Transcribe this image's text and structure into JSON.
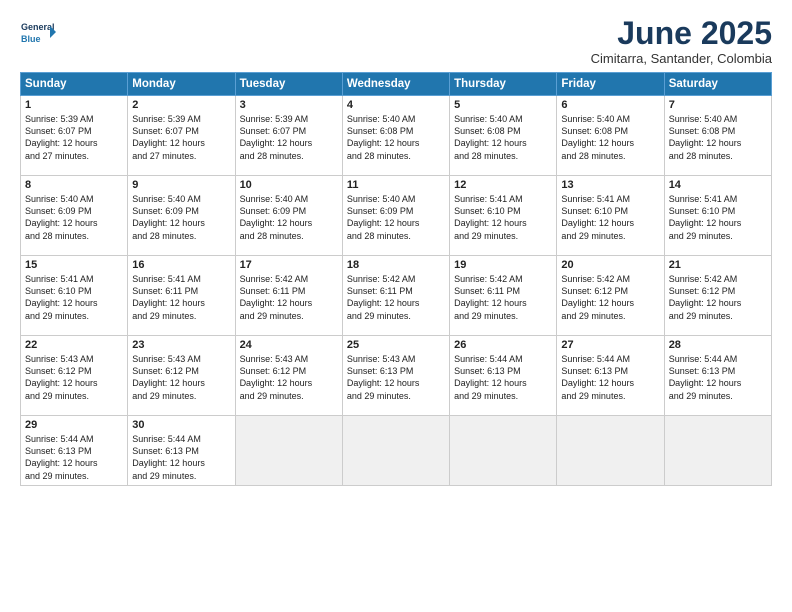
{
  "logo": {
    "line1": "General",
    "line2": "Blue"
  },
  "title": "June 2025",
  "location": "Cimitarra, Santander, Colombia",
  "weekdays": [
    "Sunday",
    "Monday",
    "Tuesday",
    "Wednesday",
    "Thursday",
    "Friday",
    "Saturday"
  ],
  "weeks": [
    [
      {
        "day": "1",
        "info": "Sunrise: 5:39 AM\nSunset: 6:07 PM\nDaylight: 12 hours\nand 27 minutes."
      },
      {
        "day": "2",
        "info": "Sunrise: 5:39 AM\nSunset: 6:07 PM\nDaylight: 12 hours\nand 27 minutes."
      },
      {
        "day": "3",
        "info": "Sunrise: 5:39 AM\nSunset: 6:07 PM\nDaylight: 12 hours\nand 28 minutes."
      },
      {
        "day": "4",
        "info": "Sunrise: 5:40 AM\nSunset: 6:08 PM\nDaylight: 12 hours\nand 28 minutes."
      },
      {
        "day": "5",
        "info": "Sunrise: 5:40 AM\nSunset: 6:08 PM\nDaylight: 12 hours\nand 28 minutes."
      },
      {
        "day": "6",
        "info": "Sunrise: 5:40 AM\nSunset: 6:08 PM\nDaylight: 12 hours\nand 28 minutes."
      },
      {
        "day": "7",
        "info": "Sunrise: 5:40 AM\nSunset: 6:08 PM\nDaylight: 12 hours\nand 28 minutes."
      }
    ],
    [
      {
        "day": "8",
        "info": "Sunrise: 5:40 AM\nSunset: 6:09 PM\nDaylight: 12 hours\nand 28 minutes."
      },
      {
        "day": "9",
        "info": "Sunrise: 5:40 AM\nSunset: 6:09 PM\nDaylight: 12 hours\nand 28 minutes."
      },
      {
        "day": "10",
        "info": "Sunrise: 5:40 AM\nSunset: 6:09 PM\nDaylight: 12 hours\nand 28 minutes."
      },
      {
        "day": "11",
        "info": "Sunrise: 5:40 AM\nSunset: 6:09 PM\nDaylight: 12 hours\nand 28 minutes."
      },
      {
        "day": "12",
        "info": "Sunrise: 5:41 AM\nSunset: 6:10 PM\nDaylight: 12 hours\nand 29 minutes."
      },
      {
        "day": "13",
        "info": "Sunrise: 5:41 AM\nSunset: 6:10 PM\nDaylight: 12 hours\nand 29 minutes."
      },
      {
        "day": "14",
        "info": "Sunrise: 5:41 AM\nSunset: 6:10 PM\nDaylight: 12 hours\nand 29 minutes."
      }
    ],
    [
      {
        "day": "15",
        "info": "Sunrise: 5:41 AM\nSunset: 6:10 PM\nDaylight: 12 hours\nand 29 minutes."
      },
      {
        "day": "16",
        "info": "Sunrise: 5:41 AM\nSunset: 6:11 PM\nDaylight: 12 hours\nand 29 minutes."
      },
      {
        "day": "17",
        "info": "Sunrise: 5:42 AM\nSunset: 6:11 PM\nDaylight: 12 hours\nand 29 minutes."
      },
      {
        "day": "18",
        "info": "Sunrise: 5:42 AM\nSunset: 6:11 PM\nDaylight: 12 hours\nand 29 minutes."
      },
      {
        "day": "19",
        "info": "Sunrise: 5:42 AM\nSunset: 6:11 PM\nDaylight: 12 hours\nand 29 minutes."
      },
      {
        "day": "20",
        "info": "Sunrise: 5:42 AM\nSunset: 6:12 PM\nDaylight: 12 hours\nand 29 minutes."
      },
      {
        "day": "21",
        "info": "Sunrise: 5:42 AM\nSunset: 6:12 PM\nDaylight: 12 hours\nand 29 minutes."
      }
    ],
    [
      {
        "day": "22",
        "info": "Sunrise: 5:43 AM\nSunset: 6:12 PM\nDaylight: 12 hours\nand 29 minutes."
      },
      {
        "day": "23",
        "info": "Sunrise: 5:43 AM\nSunset: 6:12 PM\nDaylight: 12 hours\nand 29 minutes."
      },
      {
        "day": "24",
        "info": "Sunrise: 5:43 AM\nSunset: 6:12 PM\nDaylight: 12 hours\nand 29 minutes."
      },
      {
        "day": "25",
        "info": "Sunrise: 5:43 AM\nSunset: 6:13 PM\nDaylight: 12 hours\nand 29 minutes."
      },
      {
        "day": "26",
        "info": "Sunrise: 5:44 AM\nSunset: 6:13 PM\nDaylight: 12 hours\nand 29 minutes."
      },
      {
        "day": "27",
        "info": "Sunrise: 5:44 AM\nSunset: 6:13 PM\nDaylight: 12 hours\nand 29 minutes."
      },
      {
        "day": "28",
        "info": "Sunrise: 5:44 AM\nSunset: 6:13 PM\nDaylight: 12 hours\nand 29 minutes."
      }
    ],
    [
      {
        "day": "29",
        "info": "Sunrise: 5:44 AM\nSunset: 6:13 PM\nDaylight: 12 hours\nand 29 minutes."
      },
      {
        "day": "30",
        "info": "Sunrise: 5:44 AM\nSunset: 6:13 PM\nDaylight: 12 hours\nand 29 minutes."
      },
      {
        "day": "",
        "info": ""
      },
      {
        "day": "",
        "info": ""
      },
      {
        "day": "",
        "info": ""
      },
      {
        "day": "",
        "info": ""
      },
      {
        "day": "",
        "info": ""
      }
    ]
  ]
}
